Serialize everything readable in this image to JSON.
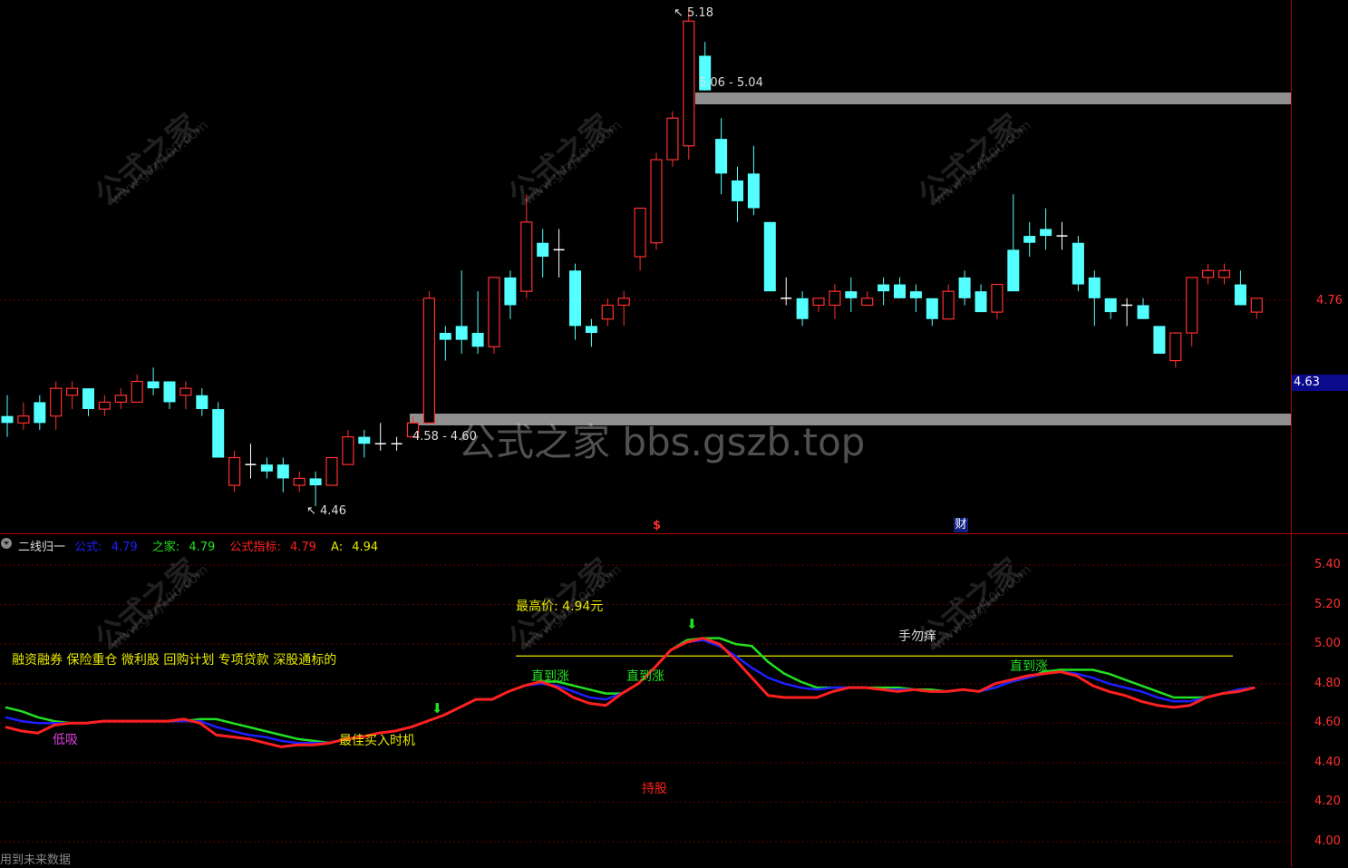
{
  "colors": {
    "bull": "#ff3030",
    "bear": "#54ffff",
    "band": "#909090",
    "frame": "#b00000",
    "grid": "#6a0000",
    "axis_text": "#ff3030",
    "ma_blue": "#1e1eff",
    "ma_green": "#22e022",
    "ma_red": "#ff2020",
    "high_line": "#e8e800"
  },
  "icons": {
    "collapse": "chevron-circle-icon",
    "buy_arrow": "down-arrow-icon"
  },
  "main_panel": {
    "y_axis_label": "4.76",
    "last_price_badge": "4.63",
    "high_label": "5.18",
    "low_label": "4.46",
    "upper_band_label": "5.06 - 5.04",
    "lower_band_label": "4.58 - 4.60",
    "upper_band_price": 5.05,
    "lower_band_price": 4.59,
    "event_marker_s": "$",
    "event_marker_fin": "财",
    "watermark_text": "公式之家 bbs.gszb.top",
    "watermark_logo": "公式之家",
    "watermark_url": "www.gszj100.com"
  },
  "indicator_panel": {
    "name": "二线归一",
    "legend": [
      {
        "name": "公式:",
        "value": "4.79",
        "color": "#1e1eff"
      },
      {
        "name": "之家:",
        "value": "4.79",
        "color": "#22e022"
      },
      {
        "name": "公式指标:",
        "value": "4.79",
        "color": "#ff2020"
      },
      {
        "name": "A:",
        "value": "4.94",
        "color": "#e8e800"
      }
    ],
    "y_ticks": [
      "5.40",
      "5.20",
      "5.00",
      "4.80",
      "4.60",
      "4.40",
      "4.20",
      "4.00"
    ],
    "annotations": {
      "tags": "融资融券 保险重仓 微利股 回购计划 专项贷款 深股通标的",
      "low_absorb": "低吸",
      "best_buy": "最佳买入时机",
      "hold": "持股",
      "high_price": "最高价: 4.94元",
      "keep_hands_off": "手勿痒",
      "until_rise_1": "直到涨",
      "until_rise_2": "直到涨",
      "until_rise_3": "直到涨"
    },
    "footer": "用到未来数据"
  },
  "chart_data": {
    "type": "candlestick",
    "y_axis_visible_label": "4.76",
    "candles": [
      {
        "o": 4.59,
        "h": 4.62,
        "l": 4.56,
        "c": 4.58
      },
      {
        "o": 4.58,
        "h": 4.61,
        "l": 4.57,
        "c": 4.59
      },
      {
        "o": 4.61,
        "h": 4.62,
        "l": 4.57,
        "c": 4.58
      },
      {
        "o": 4.59,
        "h": 4.64,
        "l": 4.57,
        "c": 4.63
      },
      {
        "o": 4.62,
        "h": 4.64,
        "l": 4.6,
        "c": 4.63
      },
      {
        "o": 4.63,
        "h": 4.63,
        "l": 4.59,
        "c": 4.6
      },
      {
        "o": 4.6,
        "h": 4.62,
        "l": 4.59,
        "c": 4.61
      },
      {
        "o": 4.61,
        "h": 4.63,
        "l": 4.6,
        "c": 4.62
      },
      {
        "o": 4.61,
        "h": 4.65,
        "l": 4.61,
        "c": 4.64
      },
      {
        "o": 4.64,
        "h": 4.66,
        "l": 4.62,
        "c": 4.63
      },
      {
        "o": 4.64,
        "h": 4.64,
        "l": 4.6,
        "c": 4.61
      },
      {
        "o": 4.62,
        "h": 4.64,
        "l": 4.6,
        "c": 4.63
      },
      {
        "o": 4.62,
        "h": 4.63,
        "l": 4.59,
        "c": 4.6
      },
      {
        "o": 4.6,
        "h": 4.61,
        "l": 4.53,
        "c": 4.53
      },
      {
        "o": 4.49,
        "h": 4.54,
        "l": 4.48,
        "c": 4.53
      },
      {
        "o": 4.52,
        "h": 4.55,
        "l": 4.5,
        "c": 4.52
      },
      {
        "o": 4.52,
        "h": 4.53,
        "l": 4.5,
        "c": 4.51
      },
      {
        "o": 4.52,
        "h": 4.53,
        "l": 4.48,
        "c": 4.5
      },
      {
        "o": 4.49,
        "h": 4.51,
        "l": 4.48,
        "c": 4.5
      },
      {
        "o": 4.5,
        "h": 4.51,
        "l": 4.46,
        "c": 4.49
      },
      {
        "o": 4.49,
        "h": 4.53,
        "l": 4.49,
        "c": 4.53
      },
      {
        "o": 4.52,
        "h": 4.57,
        "l": 4.52,
        "c": 4.56
      },
      {
        "o": 4.56,
        "h": 4.57,
        "l": 4.53,
        "c": 4.55
      },
      {
        "o": 4.55,
        "h": 4.58,
        "l": 4.54,
        "c": 4.55
      },
      {
        "o": 4.55,
        "h": 4.56,
        "l": 4.54,
        "c": 4.55
      },
      {
        "o": 4.56,
        "h": 4.59,
        "l": 4.56,
        "c": 4.58
      },
      {
        "o": 4.58,
        "h": 4.77,
        "l": 4.58,
        "c": 4.76
      },
      {
        "o": 4.71,
        "h": 4.72,
        "l": 4.67,
        "c": 4.7
      },
      {
        "o": 4.72,
        "h": 4.8,
        "l": 4.68,
        "c": 4.7
      },
      {
        "o": 4.71,
        "h": 4.77,
        "l": 4.68,
        "c": 4.69
      },
      {
        "o": 4.69,
        "h": 4.79,
        "l": 4.68,
        "c": 4.79
      },
      {
        "o": 4.79,
        "h": 4.8,
        "l": 4.73,
        "c": 4.75
      },
      {
        "o": 4.77,
        "h": 4.91,
        "l": 4.76,
        "c": 4.87
      },
      {
        "o": 4.84,
        "h": 4.86,
        "l": 4.79,
        "c": 4.82
      },
      {
        "o": 4.83,
        "h": 4.86,
        "l": 4.79,
        "c": 4.83
      },
      {
        "o": 4.8,
        "h": 4.81,
        "l": 4.7,
        "c": 4.72
      },
      {
        "o": 4.72,
        "h": 4.73,
        "l": 4.69,
        "c": 4.71
      },
      {
        "o": 4.73,
        "h": 4.76,
        "l": 4.72,
        "c": 4.75
      },
      {
        "o": 4.75,
        "h": 4.77,
        "l": 4.72,
        "c": 4.76
      },
      {
        "o": 4.82,
        "h": 4.89,
        "l": 4.8,
        "c": 4.89
      },
      {
        "o": 4.84,
        "h": 4.97,
        "l": 4.83,
        "c": 4.96
      },
      {
        "o": 4.96,
        "h": 5.03,
        "l": 4.95,
        "c": 5.02
      },
      {
        "o": 4.98,
        "h": 5.18,
        "l": 4.96,
        "c": 5.16
      },
      {
        "o": 5.11,
        "h": 5.13,
        "l": 5.06,
        "c": 5.06
      },
      {
        "o": 4.99,
        "h": 5.02,
        "l": 4.91,
        "c": 4.94
      },
      {
        "o": 4.93,
        "h": 4.95,
        "l": 4.87,
        "c": 4.9
      },
      {
        "o": 4.94,
        "h": 4.98,
        "l": 4.88,
        "c": 4.89
      },
      {
        "o": 4.87,
        "h": 4.87,
        "l": 4.77,
        "c": 4.77
      },
      {
        "o": 4.76,
        "h": 4.79,
        "l": 4.75,
        "c": 4.76
      },
      {
        "o": 4.76,
        "h": 4.77,
        "l": 4.72,
        "c": 4.73
      },
      {
        "o": 4.75,
        "h": 4.76,
        "l": 4.74,
        "c": 4.76
      },
      {
        "o": 4.75,
        "h": 4.78,
        "l": 4.73,
        "c": 4.77
      },
      {
        "o": 4.77,
        "h": 4.79,
        "l": 4.74,
        "c": 4.76
      },
      {
        "o": 4.75,
        "h": 4.77,
        "l": 4.75,
        "c": 4.76
      },
      {
        "o": 4.78,
        "h": 4.79,
        "l": 4.75,
        "c": 4.77
      },
      {
        "o": 4.78,
        "h": 4.79,
        "l": 4.76,
        "c": 4.76
      },
      {
        "o": 4.77,
        "h": 4.78,
        "l": 4.74,
        "c": 4.76
      },
      {
        "o": 4.76,
        "h": 4.76,
        "l": 4.72,
        "c": 4.73
      },
      {
        "o": 4.73,
        "h": 4.78,
        "l": 4.73,
        "c": 4.77
      },
      {
        "o": 4.79,
        "h": 4.8,
        "l": 4.75,
        "c": 4.76
      },
      {
        "o": 4.77,
        "h": 4.78,
        "l": 4.74,
        "c": 4.74
      },
      {
        "o": 4.74,
        "h": 4.76,
        "l": 4.73,
        "c": 4.78
      },
      {
        "o": 4.83,
        "h": 4.91,
        "l": 4.77,
        "c": 4.77
      },
      {
        "o": 4.85,
        "h": 4.87,
        "l": 4.82,
        "c": 4.84
      },
      {
        "o": 4.86,
        "h": 4.89,
        "l": 4.83,
        "c": 4.85
      },
      {
        "o": 4.85,
        "h": 4.87,
        "l": 4.83,
        "c": 4.85
      },
      {
        "o": 4.84,
        "h": 4.85,
        "l": 4.77,
        "c": 4.78
      },
      {
        "o": 4.79,
        "h": 4.8,
        "l": 4.72,
        "c": 4.76
      },
      {
        "o": 4.76,
        "h": 4.76,
        "l": 4.73,
        "c": 4.74
      },
      {
        "o": 4.75,
        "h": 4.76,
        "l": 4.72,
        "c": 4.75
      },
      {
        "o": 4.75,
        "h": 4.76,
        "l": 4.73,
        "c": 4.73
      },
      {
        "o": 4.72,
        "h": 4.72,
        "l": 4.68,
        "c": 4.68
      },
      {
        "o": 4.67,
        "h": 4.71,
        "l": 4.66,
        "c": 4.71
      },
      {
        "o": 4.71,
        "h": 4.79,
        "l": 4.69,
        "c": 4.79
      },
      {
        "o": 4.79,
        "h": 4.81,
        "l": 4.78,
        "c": 4.8
      },
      {
        "o": 4.79,
        "h": 4.81,
        "l": 4.78,
        "c": 4.8
      },
      {
        "o": 4.78,
        "h": 4.8,
        "l": 4.75,
        "c": 4.75
      },
      {
        "o": 4.74,
        "h": 4.76,
        "l": 4.73,
        "c": 4.76
      }
    ],
    "indicator": {
      "y_range": [
        4.0,
        5.4
      ],
      "high_line": 4.94,
      "series": [
        {
          "name": "公式",
          "values": [
            4.63,
            4.61,
            4.6,
            4.6,
            4.6,
            4.6,
            4.61,
            4.61,
            4.61,
            4.61,
            4.61,
            4.61,
            4.61,
            4.58,
            4.56,
            4.54,
            4.53,
            4.51,
            4.5,
            4.5,
            4.5,
            4.52,
            4.53,
            4.55,
            4.56,
            4.58,
            4.61,
            4.64,
            4.68,
            4.72,
            4.72,
            4.76,
            4.79,
            4.8,
            4.79,
            4.76,
            4.73,
            4.72,
            4.75,
            4.8,
            4.88,
            4.97,
            5.01,
            5.02,
            4.99,
            4.94,
            4.88,
            4.83,
            4.8,
            4.78,
            4.77,
            4.78,
            4.78,
            4.78,
            4.77,
            4.77,
            4.77,
            4.76,
            4.76,
            4.77,
            4.76,
            4.78,
            4.81,
            4.83,
            4.85,
            4.86,
            4.85,
            4.83,
            4.8,
            4.78,
            4.76,
            4.73,
            4.71,
            4.71,
            4.73,
            4.75,
            4.77,
            4.78
          ]
        },
        {
          "name": "之家",
          "values": [
            4.68,
            4.66,
            4.63,
            4.61,
            4.6,
            4.6,
            4.61,
            4.61,
            4.61,
            4.61,
            4.61,
            4.61,
            4.62,
            4.62,
            4.6,
            4.58,
            4.56,
            4.54,
            4.52,
            4.51,
            4.5,
            4.52,
            4.53,
            4.55,
            4.56,
            4.58,
            4.61,
            4.64,
            4.68,
            4.72,
            4.72,
            4.76,
            4.79,
            4.81,
            4.81,
            4.79,
            4.77,
            4.75,
            4.75,
            4.8,
            4.88,
            4.97,
            5.02,
            5.03,
            5.03,
            5.0,
            4.99,
            4.91,
            4.85,
            4.81,
            4.78,
            4.78,
            4.78,
            4.78,
            4.78,
            4.78,
            4.77,
            4.77,
            4.76,
            4.77,
            4.76,
            4.78,
            4.81,
            4.83,
            4.86,
            4.87,
            4.87,
            4.87,
            4.85,
            4.82,
            4.79,
            4.76,
            4.73,
            4.73,
            4.73,
            4.75,
            4.77,
            4.78
          ]
        },
        {
          "name": "公式指标",
          "values": [
            4.58,
            4.56,
            4.55,
            4.59,
            4.6,
            4.6,
            4.61,
            4.61,
            4.61,
            4.61,
            4.61,
            4.62,
            4.6,
            4.54,
            4.53,
            4.52,
            4.5,
            4.48,
            4.49,
            4.49,
            4.5,
            4.52,
            4.53,
            4.55,
            4.56,
            4.58,
            4.61,
            4.64,
            4.68,
            4.72,
            4.72,
            4.76,
            4.79,
            4.81,
            4.78,
            4.73,
            4.7,
            4.69,
            4.75,
            4.8,
            4.88,
            4.97,
            5.01,
            5.03,
            5.0,
            4.92,
            4.83,
            4.74,
            4.73,
            4.73,
            4.73,
            4.76,
            4.78,
            4.78,
            4.77,
            4.76,
            4.77,
            4.76,
            4.76,
            4.77,
            4.76,
            4.8,
            4.82,
            4.84,
            4.85,
            4.86,
            4.84,
            4.79,
            4.76,
            4.74,
            4.71,
            4.69,
            4.68,
            4.69,
            4.73,
            4.75,
            4.76,
            4.78
          ]
        }
      ]
    }
  }
}
